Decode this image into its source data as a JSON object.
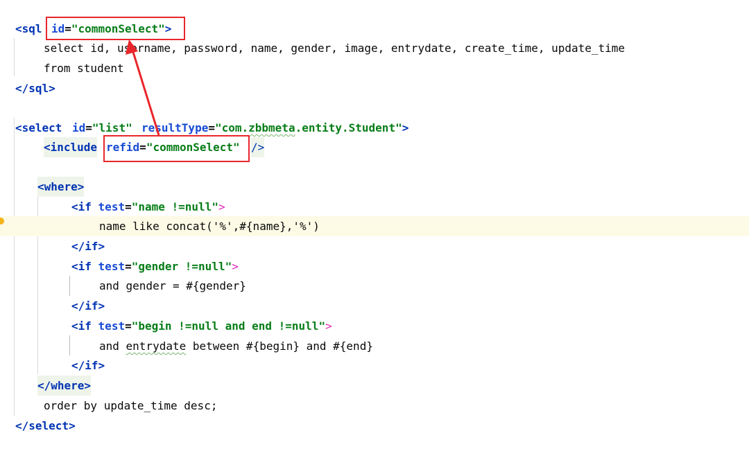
{
  "code": {
    "sql_open_tag": "<sql",
    "sql_id_attr": "id=\"commonSelect\">",
    "sql_select_line": "select id, username, password, name, gender, image, entrydate, create_time, update_time",
    "sql_from_line": "from student",
    "sql_close_tag": "</sql>",
    "select_open": "<select",
    "select_id_attr": "id=\"list\"",
    "select_result_attr": "resultType=\"com.zbbmeta.entity.Student\">",
    "include_open": "<include",
    "include_refid_attr": "refid=\"commonSelect\"",
    "include_close": "/>",
    "where_open": "<where>",
    "if1_open": "<if test=\"name !=null\">",
    "if1_body": "name like concat('%',#{name},'%')",
    "if_close": "</if>",
    "if2_open": "<if test=\"gender !=null\">",
    "if2_body": "and gender = #{gender}",
    "if3_open": "<if test=\"begin !=null and end !=null\">",
    "if3_body": "and entrydate between #{begin} and #{end}",
    "where_close": "</where>",
    "order_line": "order by update_time desc;",
    "select_close": "</select>"
  },
  "colors": {
    "annotation": "#e8262b",
    "tag": "#0033b3",
    "string": "#067d17",
    "highlight_line": "#fdfbe6"
  }
}
